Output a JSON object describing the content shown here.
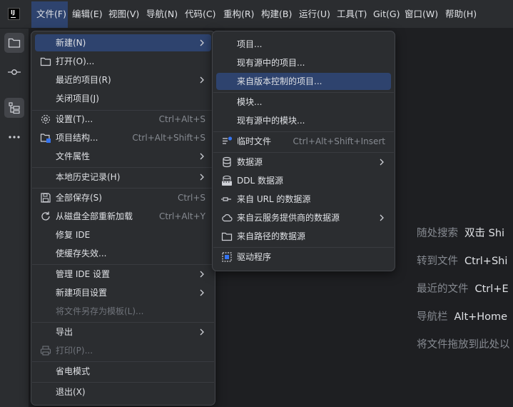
{
  "menubar": {
    "items": [
      "文件(F)",
      "编辑(E)",
      "视图(V)",
      "导航(N)",
      "代码(C)",
      "重构(R)",
      "构建(B)",
      "运行(U)",
      "工具(T)",
      "Git(G)",
      "窗口(W)",
      "帮助(H)"
    ]
  },
  "file_menu": {
    "items": [
      {
        "label": "新建(N)",
        "shortcut": ""
      },
      {
        "label": "打开(O)...",
        "shortcut": ""
      },
      {
        "label": "最近的项目(R)",
        "shortcut": ""
      },
      {
        "label": "关闭项目(J)",
        "shortcut": ""
      },
      {
        "label": "设置(T)...",
        "shortcut": "Ctrl+Alt+S"
      },
      {
        "label": "项目结构...",
        "shortcut": "Ctrl+Alt+Shift+S"
      },
      {
        "label": "文件属性",
        "shortcut": ""
      },
      {
        "label": "本地历史记录(H)",
        "shortcut": ""
      },
      {
        "label": "全部保存(S)",
        "shortcut": "Ctrl+S"
      },
      {
        "label": "从磁盘全部重新加载",
        "shortcut": "Ctrl+Alt+Y"
      },
      {
        "label": "修复 IDE",
        "shortcut": ""
      },
      {
        "label": "使缓存失效...",
        "shortcut": ""
      },
      {
        "label": "管理 IDE 设置",
        "shortcut": ""
      },
      {
        "label": "新建项目设置",
        "shortcut": ""
      },
      {
        "label": "将文件另存为模板(L)...",
        "shortcut": ""
      },
      {
        "label": "导出",
        "shortcut": ""
      },
      {
        "label": "打印(P)...",
        "shortcut": ""
      },
      {
        "label": "省电模式",
        "shortcut": ""
      },
      {
        "label": "退出(X)",
        "shortcut": ""
      }
    ]
  },
  "new_submenu": {
    "items": [
      {
        "label": "项目...",
        "shortcut": ""
      },
      {
        "label": "现有源中的项目...",
        "shortcut": ""
      },
      {
        "label": "来自版本控制的项目...",
        "shortcut": ""
      },
      {
        "label": "模块...",
        "shortcut": ""
      },
      {
        "label": "现有源中的模块...",
        "shortcut": ""
      },
      {
        "label": "临时文件",
        "shortcut": "Ctrl+Alt+Shift+Insert"
      },
      {
        "label": "数据源",
        "shortcut": ""
      },
      {
        "label": "DDL 数据源",
        "shortcut": ""
      },
      {
        "label": "来自 URL 的数据源",
        "shortcut": ""
      },
      {
        "label": "来自云服务提供商的数据源",
        "shortcut": ""
      },
      {
        "label": "来自路径的数据源",
        "shortcut": ""
      },
      {
        "label": "驱动程序",
        "shortcut": ""
      }
    ]
  },
  "welcome_hints": [
    {
      "text": "随处搜索",
      "key": "双击 Shi"
    },
    {
      "text": "转到文件",
      "key": "Ctrl+Shi"
    },
    {
      "text": "最近的文件",
      "key": "Ctrl+E"
    },
    {
      "text": "导航栏",
      "key": "Alt+Home"
    },
    {
      "text": "将文件拖放到此处以",
      "key": ""
    }
  ],
  "colors": {
    "accent": "#2e436e",
    "background": "#1e1f22",
    "panel": "#2b2d30"
  }
}
